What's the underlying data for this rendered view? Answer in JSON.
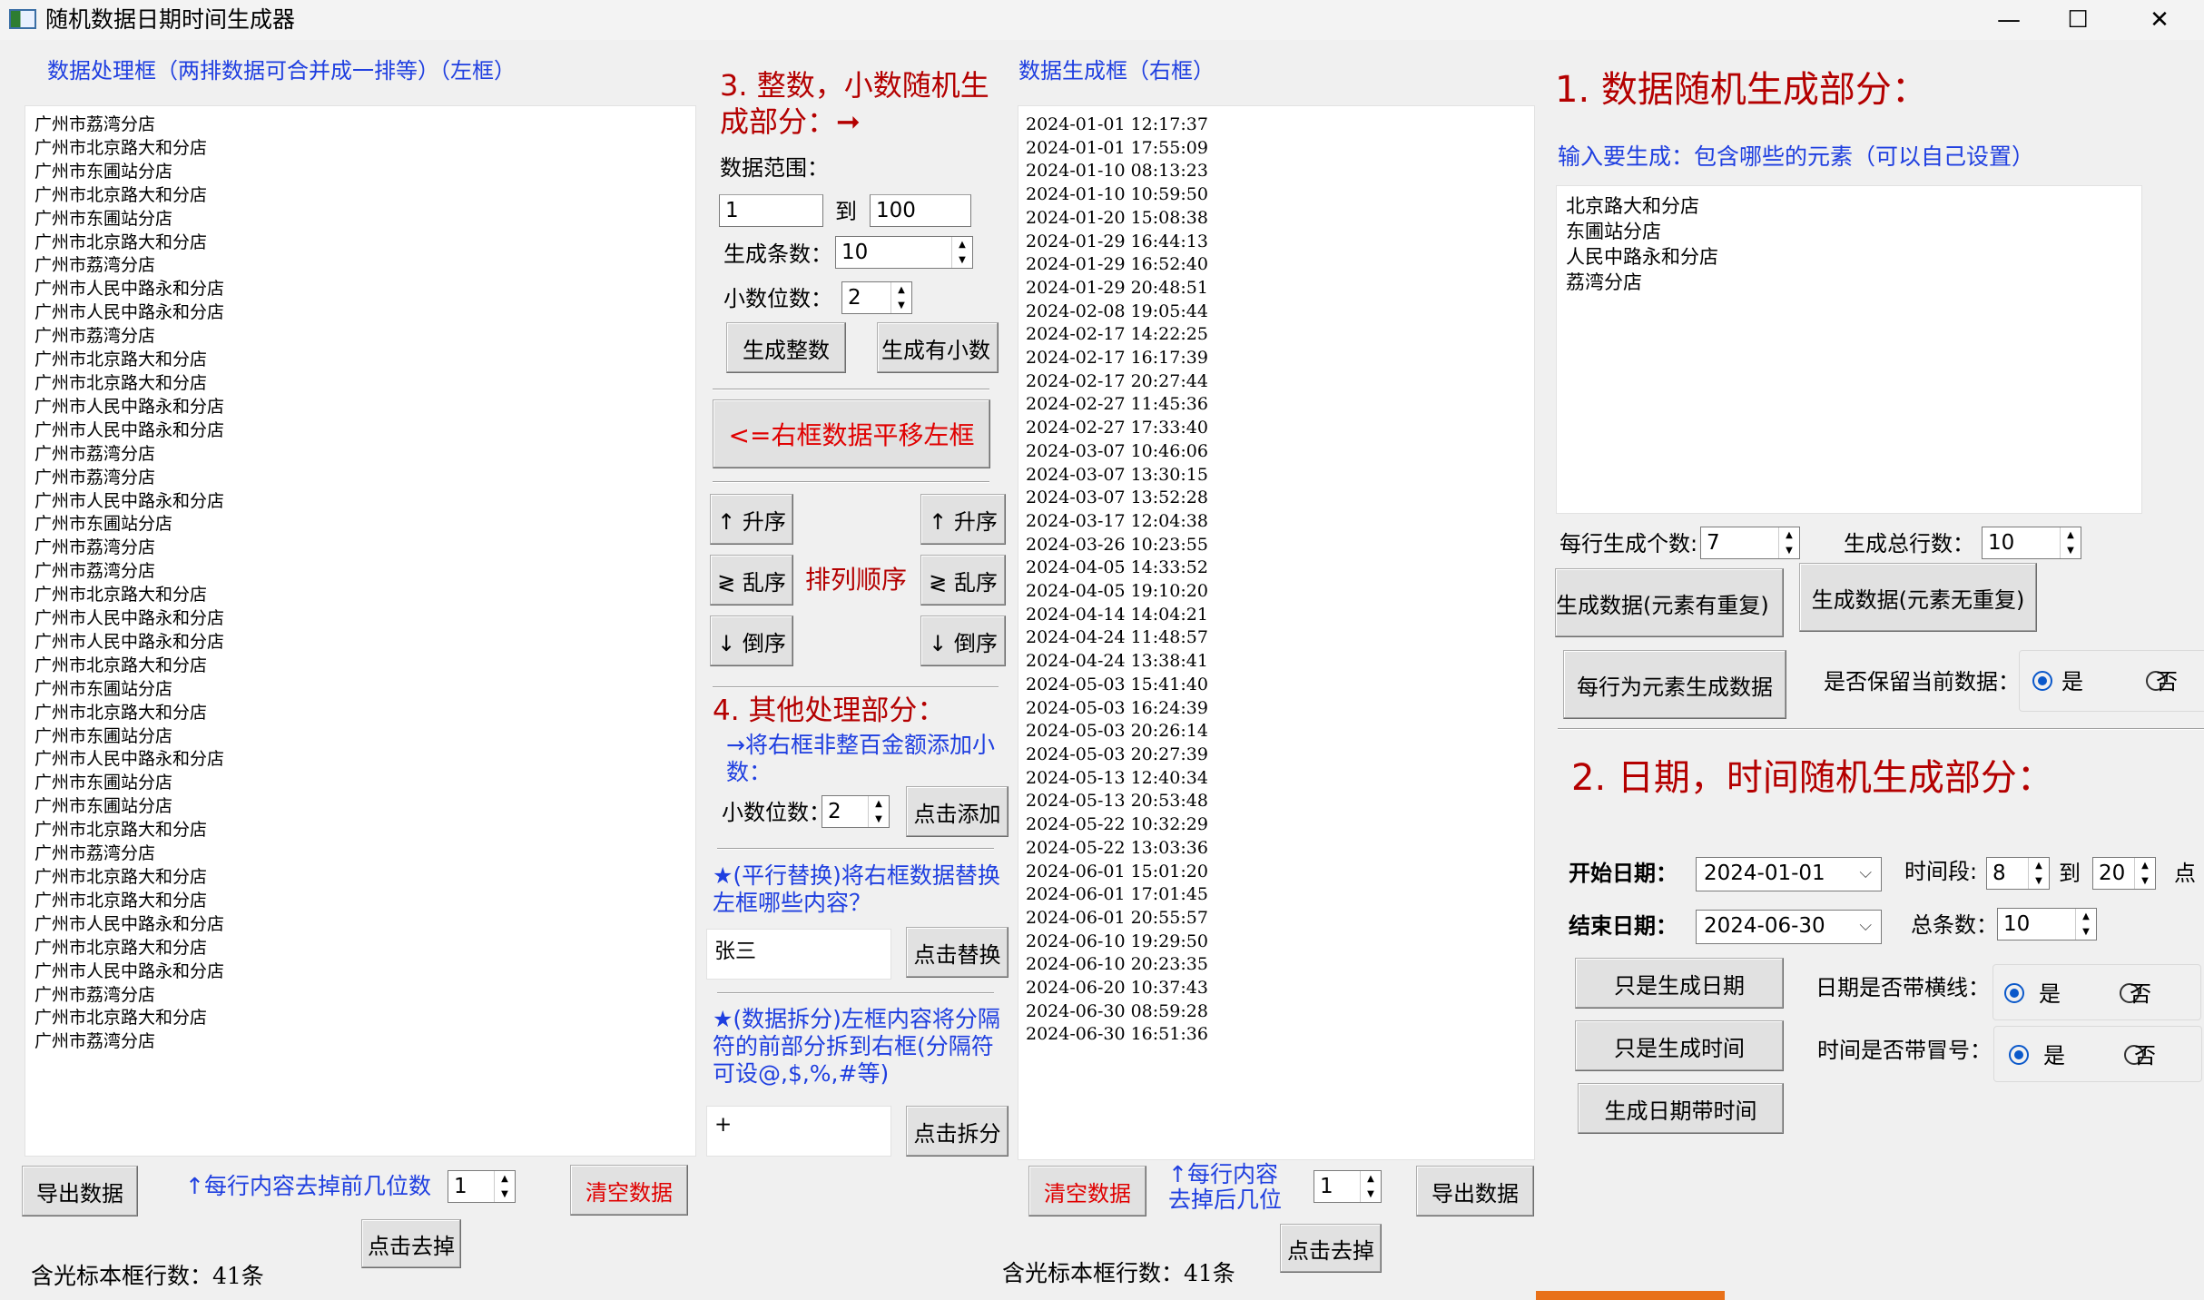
{
  "window": {
    "title": "随机数据日期时间生成器",
    "minimize": "—",
    "maximize": "☐",
    "close": "✕"
  },
  "left": {
    "header": "数据处理框（两排数据可合并成一排等）（左框）",
    "lines": [
      "广州市荔湾分店",
      "广州市北京路大和分店",
      "广州市东圃站分店",
      "广州市北京路大和分店",
      "广州市东圃站分店",
      "广州市北京路大和分店",
      "广州市荔湾分店",
      "广州市人民中路永和分店",
      "广州市人民中路永和分店",
      "广州市荔湾分店",
      "广州市北京路大和分店",
      "广州市北京路大和分店",
      "广州市人民中路永和分店",
      "广州市人民中路永和分店",
      "广州市荔湾分店",
      "广州市荔湾分店",
      "广州市人民中路永和分店",
      "广州市东圃站分店",
      "广州市荔湾分店",
      "广州市荔湾分店",
      "广州市北京路大和分店",
      "广州市人民中路永和分店",
      "广州市人民中路永和分店",
      "广州市北京路大和分店",
      "广州市东圃站分店",
      "广州市北京路大和分店",
      "广州市东圃站分店",
      "广州市人民中路永和分店",
      "广州市东圃站分店",
      "广州市东圃站分店",
      "广州市北京路大和分店",
      "广州市荔湾分店",
      "广州市北京路大和分店",
      "广州市北京路大和分店",
      "广州市人民中路永和分店",
      "广州市北京路大和分店",
      "广州市人民中路永和分店",
      "广州市荔湾分店",
      "广州市北京路大和分店",
      "广州市荔湾分店"
    ],
    "export_label": "导出数据",
    "trim_label": "↑每行内容去掉前几位数",
    "trim_value": "1",
    "clear_label": "清空数据",
    "apply_trim_label": "点击去掉",
    "line_count": "含光标本框行数：41条"
  },
  "middle": {
    "section3_title": "3. 整数，小数随机生成部分：➞",
    "range_label": "数据范围：",
    "range_from": "1",
    "range_to_label": "到",
    "range_to": "100",
    "count_label": "生成条数：",
    "count_value": "10",
    "decimals_label": "小数位数：",
    "decimals_value": "2",
    "gen_int_label": "生成整数",
    "gen_dec_label": "生成有小数",
    "shift_label": "<=右框数据平移左框",
    "asc_label": "↑ 升序",
    "shuffle_label": "≷ 乱序",
    "desc_label": "↓ 倒序",
    "sort_title": "排列顺序",
    "section4_title": "4. 其他处理部分：",
    "add_decimal_desc": "→将右框非整百金额添加小数：",
    "add_decimals_label": "小数位数：",
    "add_decimals_value": "2",
    "add_label": "点击添加",
    "replace_desc": "★(平行替换)将右框数据替换左框哪些内容？",
    "replace_value": "张三",
    "replace_label": "点击替换",
    "split_desc": "★(数据拆分)左框内容将分隔符的前部分拆到右框(分隔符可设@,$,%,#等)",
    "split_value": "+",
    "split_label": "点击拆分"
  },
  "right": {
    "header": "数据生成框（右框）",
    "lines": [
      "2024-01-01 12:17:37",
      "2024-01-01 17:55:09",
      "2024-01-10 08:13:23",
      "2024-01-10 10:59:50",
      "2024-01-20 15:08:38",
      "2024-01-29 16:44:13",
      "2024-01-29 16:52:40",
      "2024-01-29 20:48:51",
      "2024-02-08 19:05:44",
      "2024-02-17 14:22:25",
      "2024-02-17 16:17:39",
      "2024-02-17 20:27:44",
      "2024-02-27 11:45:36",
      "2024-02-27 17:33:40",
      "2024-03-07 10:46:06",
      "2024-03-07 13:30:15",
      "2024-03-07 13:52:28",
      "2024-03-17 12:04:38",
      "2024-03-26 10:23:55",
      "2024-04-05 14:33:52",
      "2024-04-05 19:10:20",
      "2024-04-14 14:04:21",
      "2024-04-24 11:48:57",
      "2024-04-24 13:38:41",
      "2024-05-03 15:41:40",
      "2024-05-03 16:24:39",
      "2024-05-03 20:26:14",
      "2024-05-03 20:27:39",
      "2024-05-13 12:40:34",
      "2024-05-13 20:53:48",
      "2024-05-22 10:32:29",
      "2024-05-22 13:03:36",
      "2024-06-01 15:01:20",
      "2024-06-01 17:01:45",
      "2024-06-01 20:55:57",
      "2024-06-10 19:29:50",
      "2024-06-10 20:23:35",
      "2024-06-20 10:37:43",
      "2024-06-30 08:59:28",
      "2024-06-30 16:51:36"
    ],
    "clear_label": "清空数据",
    "trim_label": "↑每行内容去掉后几位数？",
    "trim_value": "1",
    "export_label": "导出数据",
    "apply_trim_label": "点击去掉",
    "line_count": "含光标本框行数：41条"
  },
  "gen": {
    "section1_title": "1. 数据随机生成部分：",
    "elements_label": "输入要生成：包含哪些的元素（可以自己设置）",
    "elements": [
      "北京路大和分店",
      "东圃站分店",
      "人民中路永和分店",
      "荔湾分店"
    ],
    "per_row_label": "每行生成个数:",
    "per_row_value": "7",
    "total_rows_label": "生成总行数：",
    "total_rows_value": "10",
    "gen_repeat_label": "生成数据(元素有重复)",
    "gen_norepeat_label": "生成数据(元素无重复)",
    "gen_per_element_label": "每行为元素生成数据",
    "keep_label": "是否保留当前数据：",
    "yes": "是",
    "no": "否",
    "section2_title": "2. 日期，时间随机生成部分：",
    "start_date_label": "开始日期：",
    "start_date": "2024-01-01",
    "time_range_label": "时间段:",
    "time_from": "8",
    "time_to_label": "到",
    "time_to": "20",
    "time_unit": "点",
    "end_date_label": "结束日期：",
    "end_date": "2024-06-30",
    "total_label": "总条数：",
    "total_value": "10",
    "only_date_label": "只是生成日期",
    "only_time_label": "只是生成时间",
    "date_time_label": "生成日期带时间",
    "date_dash_label": "日期是否带横线：",
    "time_colon_label": "时间是否带冒号："
  }
}
